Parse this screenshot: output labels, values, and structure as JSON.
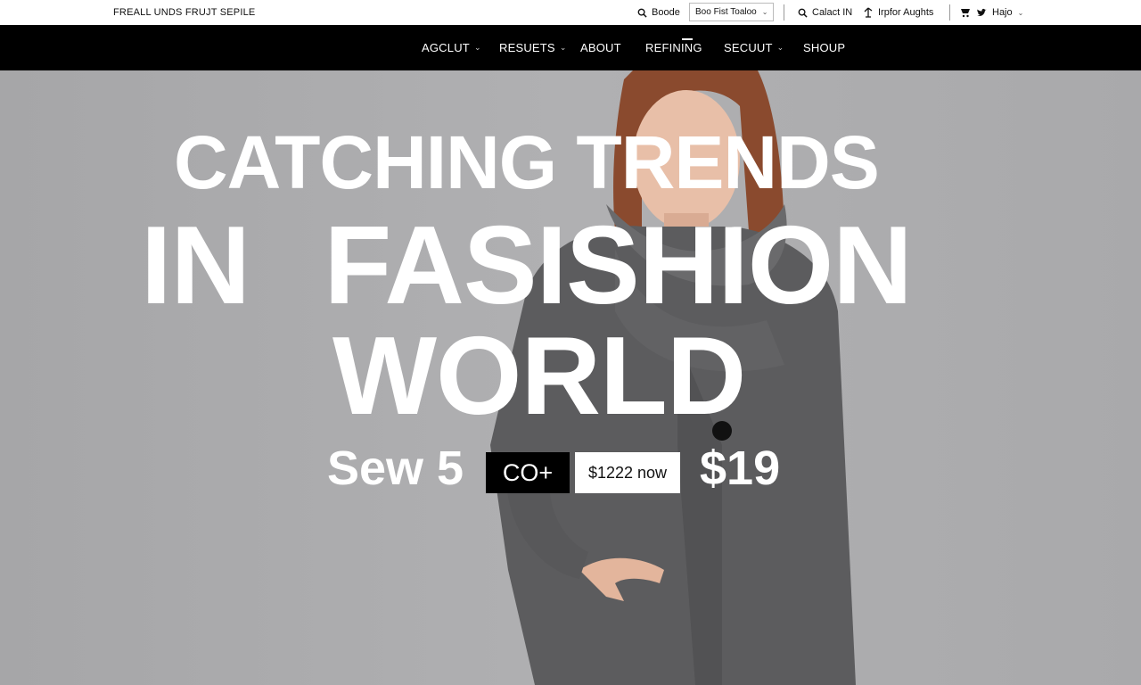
{
  "topbar": {
    "brand": "FREALL UNDS FRUJT SEPILE",
    "search_label": "Boode",
    "select_value": "Boo Fist Toaloo",
    "contact_label": "Calact IN",
    "import_label": "Irpfor Aughts",
    "help_label": "Hajo"
  },
  "nav": {
    "items": [
      {
        "label": "AGCLUT"
      },
      {
        "label": "RESUETS"
      },
      {
        "label": "ABOUT"
      },
      {
        "label": "REFINING"
      },
      {
        "label": "SECUUT"
      },
      {
        "label": "SHOUP"
      }
    ]
  },
  "hero": {
    "line1": "CATCHING TRENDS",
    "line2": "IN FASISHION",
    "line3": "WORLD",
    "promo_text": "Sew 5",
    "promo_tag": "CO+",
    "promo_button": "$1222 now",
    "promo_price": "$19"
  },
  "colors": {
    "nav_bg": "#000000",
    "hero_bg": "#a9a9ab",
    "coat": "#5c5c5e"
  }
}
